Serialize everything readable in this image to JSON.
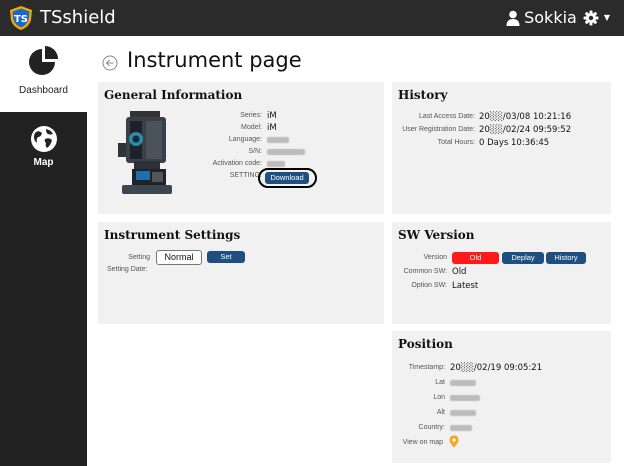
{
  "app": {
    "title": "TSshield",
    "user_name": "Sokkia"
  },
  "sidebar": {
    "items": [
      {
        "label": "Dashboard",
        "icon": "pie-chart-icon",
        "active": true
      },
      {
        "label": "Map",
        "icon": "globe-icon",
        "active": false
      }
    ]
  },
  "page": {
    "title": "Instrument page"
  },
  "general_information": {
    "title": "General Information",
    "series_label": "Series:",
    "series_value": "iM",
    "model_label": "Model:",
    "model_value": "iM",
    "language_label": "Language:",
    "sn_label": "S/N:",
    "activation_label": "Activation code:",
    "setting_label": "SETTING:",
    "download_label": "Download"
  },
  "history": {
    "title": "History",
    "last_access_label": "Last Access Date:",
    "last_access_value": "20░░/03/08 10:21:16",
    "registration_label": "User Registration Date:",
    "registration_value": "20░░/02/24 09:59:52",
    "total_hours_label": "Total Hours:",
    "total_hours_value": "0 Days 10:36:45"
  },
  "instrument_settings": {
    "title": "Instrument Settings",
    "setting_label": "Setting",
    "setting_value": "Normal",
    "set_label": "Set",
    "setting_date_label": "Setting Date:"
  },
  "sw_version": {
    "title": "SW Version",
    "version_label": "Version",
    "old_label": "Old",
    "deplay_label": "Deplay",
    "history_label": "History",
    "common_sw_label": "Common SW:",
    "common_sw_value": "Old",
    "option_sw_label": "Option SW:",
    "option_sw_value": "Latest"
  },
  "position": {
    "title": "Position",
    "timestamp_label": "Timestamp:",
    "timestamp_value": "20░░/02/19 09:05:21",
    "lat_label": "Lat",
    "lon_label": "Lon",
    "alt_label": "Alt",
    "country_label": "Country:",
    "view_on_map_label": "View on map"
  },
  "colors": {
    "topbar": "#2b2b2b",
    "sidebar": "#222222",
    "panel": "#f1f1f1",
    "button": "#1f4f7f",
    "old": "#ff1a1a",
    "pin": "#f5a623"
  }
}
